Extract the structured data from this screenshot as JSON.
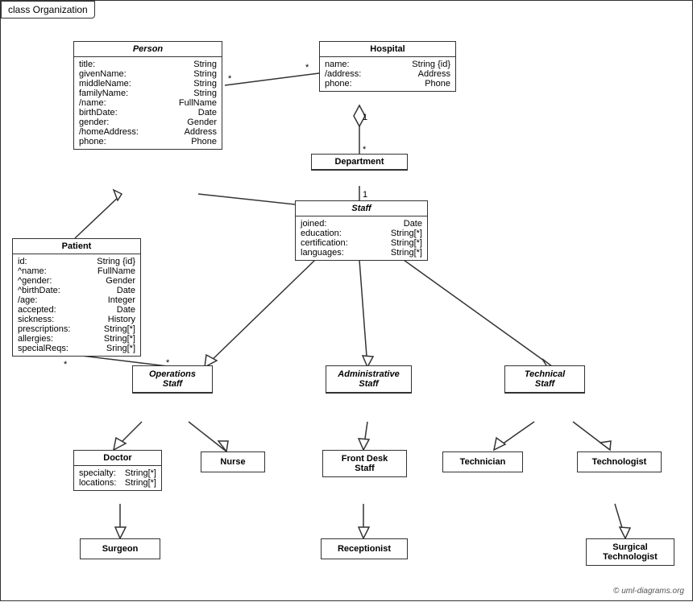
{
  "title": "class Organization",
  "classes": {
    "person": {
      "name": "Person",
      "italic": true,
      "attrs": [
        {
          "name": "title:",
          "type": "String"
        },
        {
          "name": "givenName:",
          "type": "String"
        },
        {
          "name": "middleName:",
          "type": "String"
        },
        {
          "name": "familyName:",
          "type": "String"
        },
        {
          "name": "/name:",
          "type": "FullName"
        },
        {
          "name": "birthDate:",
          "type": "Date"
        },
        {
          "name": "gender:",
          "type": "Gender"
        },
        {
          "name": "/homeAddress:",
          "type": "Address"
        },
        {
          "name": "phone:",
          "type": "Phone"
        }
      ]
    },
    "hospital": {
      "name": "Hospital",
      "italic": false,
      "attrs": [
        {
          "name": "name:",
          "type": "String {id}"
        },
        {
          "name": "/address:",
          "type": "Address"
        },
        {
          "name": "phone:",
          "type": "Phone"
        }
      ]
    },
    "patient": {
      "name": "Patient",
      "italic": false,
      "attrs": [
        {
          "name": "id:",
          "type": "String {id}"
        },
        {
          "name": "^name:",
          "type": "FullName"
        },
        {
          "name": "^gender:",
          "type": "Gender"
        },
        {
          "name": "^birthDate:",
          "type": "Date"
        },
        {
          "name": "/age:",
          "type": "Integer"
        },
        {
          "name": "accepted:",
          "type": "Date"
        },
        {
          "name": "sickness:",
          "type": "History"
        },
        {
          "name": "prescriptions:",
          "type": "String[*]"
        },
        {
          "name": "allergies:",
          "type": "String[*]"
        },
        {
          "name": "specialReqs:",
          "type": "Sring[*]"
        }
      ]
    },
    "department": {
      "name": "Department",
      "italic": false
    },
    "staff": {
      "name": "Staff",
      "italic": true,
      "attrs": [
        {
          "name": "joined:",
          "type": "Date"
        },
        {
          "name": "education:",
          "type": "String[*]"
        },
        {
          "name": "certification:",
          "type": "String[*]"
        },
        {
          "name": "languages:",
          "type": "String[*]"
        }
      ]
    },
    "operations_staff": {
      "name": "Operations Staff",
      "italic": true
    },
    "admin_staff": {
      "name": "Administrative Staff",
      "italic": true
    },
    "technical_staff": {
      "name": "Technical Staff",
      "italic": true
    },
    "doctor": {
      "name": "Doctor",
      "italic": false,
      "attrs": [
        {
          "name": "specialty:",
          "type": "String[*]"
        },
        {
          "name": "locations:",
          "type": "String[*]"
        }
      ]
    },
    "nurse": {
      "name": "Nurse",
      "italic": false
    },
    "front_desk": {
      "name": "Front Desk Staff",
      "italic": false
    },
    "technician": {
      "name": "Technician",
      "italic": false
    },
    "technologist": {
      "name": "Technologist",
      "italic": false
    },
    "surgeon": {
      "name": "Surgeon",
      "italic": false
    },
    "receptionist": {
      "name": "Receptionist",
      "italic": false
    },
    "surgical_technologist": {
      "name": "Surgical Technologist",
      "italic": false
    }
  },
  "copyright": "© uml-diagrams.org"
}
